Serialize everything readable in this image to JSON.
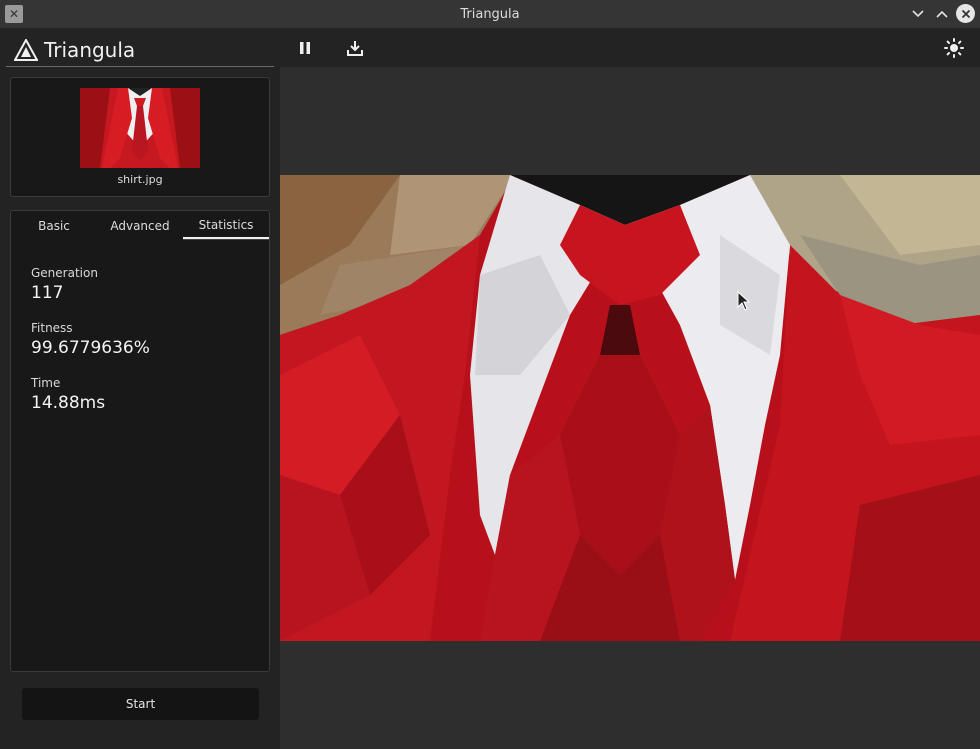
{
  "window": {
    "title": "Triangula"
  },
  "brand": {
    "name": "Triangula"
  },
  "thumbnail": {
    "filename": "shirt.jpg"
  },
  "tabs": [
    {
      "label": "Basic",
      "active": false
    },
    {
      "label": "Advanced",
      "active": false
    },
    {
      "label": "Statistics",
      "active": true
    }
  ],
  "stats": {
    "generation": {
      "label": "Generation",
      "value": "117"
    },
    "fitness": {
      "label": "Fitness",
      "value": "99.6779636%"
    },
    "time": {
      "label": "Time",
      "value": "14.88ms"
    }
  },
  "actions": {
    "start_label": "Start"
  },
  "colors": {
    "sidebar_bg": "#232323",
    "panel_bg": "#181818",
    "main_bg": "#2e2e2e",
    "suit_red": "#c4141c",
    "shirt_white": "#e8e8ec"
  },
  "icons": {
    "toolbar": [
      "pause-icon",
      "download-icon",
      "sun-icon"
    ],
    "window": [
      "minimize-icon",
      "maximize-icon",
      "close-icon"
    ]
  }
}
